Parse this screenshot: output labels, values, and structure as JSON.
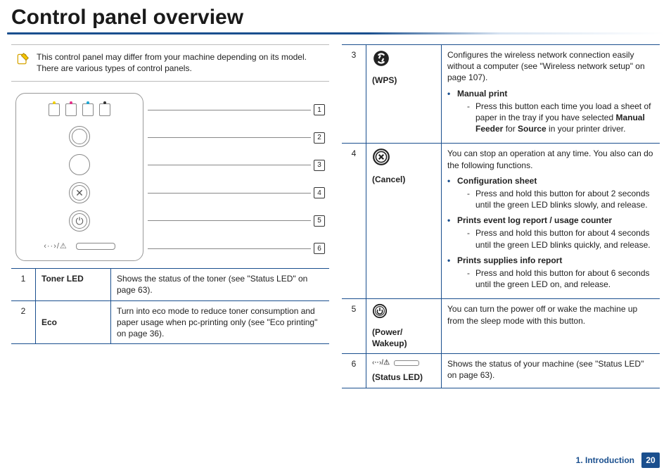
{
  "title": "Control panel overview",
  "note": "This control panel may differ from your machine depending on its model. There are various types of control panels.",
  "diagram": {
    "callouts": [
      "1",
      "2",
      "3",
      "4",
      "5",
      "6"
    ]
  },
  "left_table": [
    {
      "idx": "1",
      "label": "Toner LED",
      "body": "Shows the status of the toner (see \"Status LED\" on page 63)."
    },
    {
      "idx": "2",
      "label": "Eco",
      "body": "Turn into eco mode to reduce toner consumption and paper usage when pc-printing only (see \"Eco printing\" on page 36)."
    }
  ],
  "right_table": {
    "row3": {
      "idx": "3",
      "label": "(WPS)",
      "lead": "Configures the wireless network connection easily without a computer (see \"Wireless network setup\" on page 107).",
      "feature_title": "Manual print",
      "feature_sub": "Press this button each time you load a sheet of paper in the tray if you have selected Manual Feeder for Source in your printer driver."
    },
    "row4": {
      "idx": "4",
      "label": "(Cancel)",
      "lead": "You can stop an operation at any time. You also can do the following functions.",
      "f1_title": "Configuration sheet",
      "f1_sub": "Press and hold this button for about 2 seconds until the green LED blinks slowly, and release.",
      "f2_title": "Prints event log report / usage counter",
      "f2_sub": "Press and hold this button for about 4 seconds until the green LED blinks quickly, and release.",
      "f3_title": "Prints supplies info report",
      "f3_sub": "Press and hold this button for about 6 seconds until the green LED on, and release."
    },
    "row5": {
      "idx": "5",
      "label": "(Power/ Wakeup)",
      "body": "You can turn the power off or wake the machine up from the sleep mode with this button."
    },
    "row6": {
      "idx": "6",
      "label": "(Status LED)",
      "body": "Shows the status of your machine (see \"Status LED\" on page 63)."
    }
  },
  "footer": {
    "chapter": "1. Introduction",
    "page": "20"
  }
}
